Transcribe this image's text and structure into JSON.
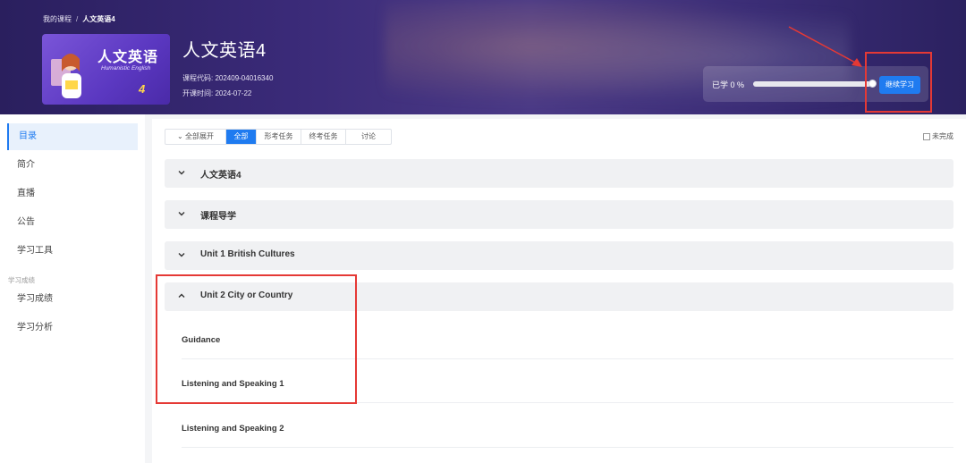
{
  "breadcrumb": {
    "root": "我的课程",
    "separator": "/",
    "current": "人文英语4"
  },
  "cover": {
    "title": "人文英语",
    "subtitle": "Humanistic English",
    "number": "4"
  },
  "course": {
    "title": "人文英语4",
    "code": "课程代码: 202409-04016340",
    "start_time": "开课时间: 2024-07-22"
  },
  "progress": {
    "label": "已学 0 %",
    "value_percent": 0,
    "continue_label": "继续学习"
  },
  "sidebar": {
    "items": [
      {
        "label": "目录",
        "active": true
      },
      {
        "label": "简介"
      },
      {
        "label": "直播"
      },
      {
        "label": "公告"
      },
      {
        "label": "学习工具"
      }
    ],
    "section_label": "学习成绩",
    "section_items": [
      {
        "label": "学习成绩"
      },
      {
        "label": "学习分析"
      }
    ]
  },
  "toolbar": {
    "expand_label": "全部展开",
    "filters": [
      "全部",
      "形考任务",
      "终考任务",
      "讨论"
    ],
    "unfinished_label": "未完成"
  },
  "chapters": [
    {
      "title": "人文英语4",
      "expanded": false
    },
    {
      "title": "课程导学",
      "expanded": false
    },
    {
      "title": "Unit 1 British Cultures",
      "expanded": false
    },
    {
      "title": "Unit 2 City or Country",
      "expanded": true
    }
  ],
  "lessons": [
    "Guidance",
    "Listening and Speaking 1",
    "Listening and Speaking 2"
  ],
  "colors": {
    "accent": "#1f7bf0",
    "annotation": "#e53935"
  }
}
